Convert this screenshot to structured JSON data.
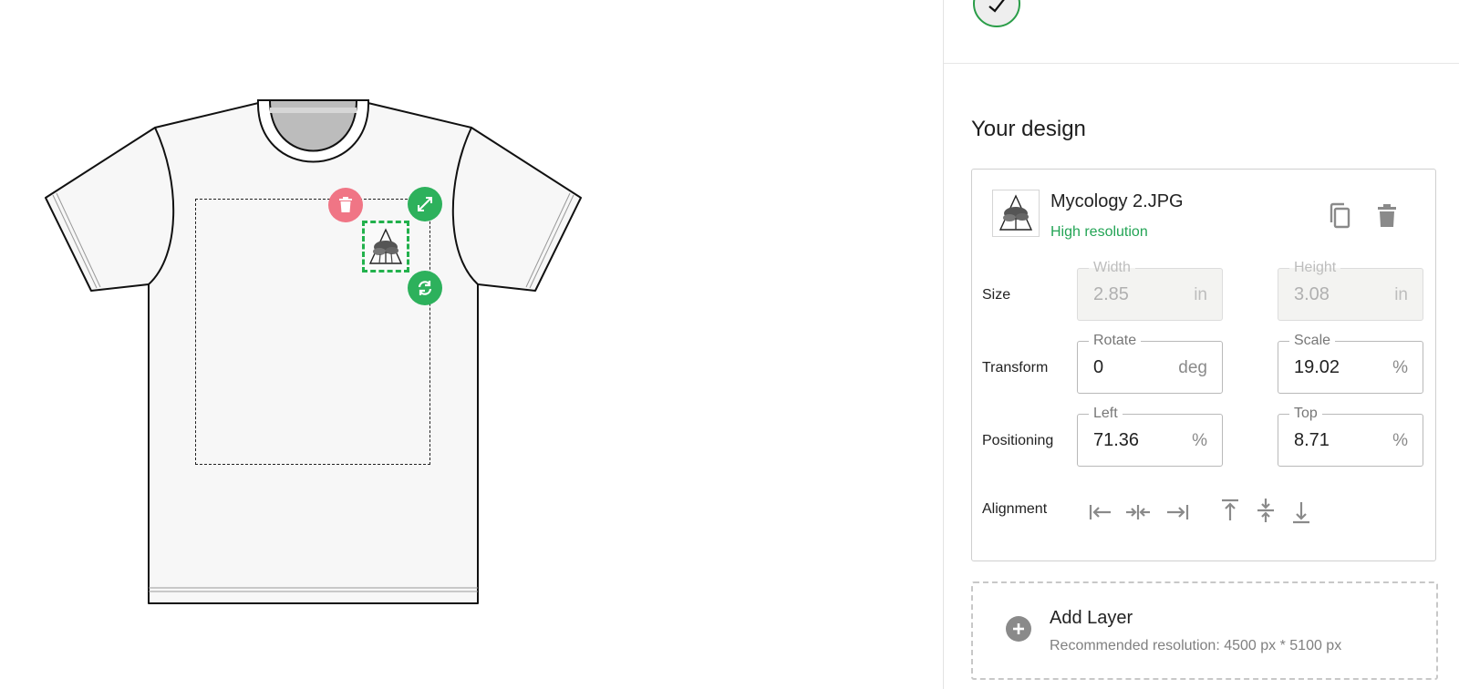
{
  "panel": {
    "title": "Your design",
    "layer": {
      "file_name": "Mycology 2.JPG",
      "resolution_status": "High resolution",
      "size": {
        "label": "Size",
        "width": {
          "legend": "Width",
          "value": "2.85",
          "unit": "in"
        },
        "height": {
          "legend": "Height",
          "value": "3.08",
          "unit": "in"
        }
      },
      "transform": {
        "label": "Transform",
        "rotate": {
          "legend": "Rotate",
          "value": "0",
          "unit": "deg"
        },
        "scale": {
          "legend": "Scale",
          "value": "19.02",
          "unit": "%"
        }
      },
      "positioning": {
        "label": "Positioning",
        "left": {
          "legend": "Left",
          "value": "71.36",
          "unit": "%"
        },
        "top": {
          "legend": "Top",
          "value": "8.71",
          "unit": "%"
        }
      },
      "alignment": {
        "label": "Alignment"
      }
    },
    "add_layer": {
      "title": "Add Layer",
      "subtitle": "Recommended resolution: 4500 px * 5100 px"
    }
  },
  "colors": {
    "accent_green": "#2db15c",
    "delete_pink": "#f07585",
    "status_green": "#23a455"
  },
  "icons": {
    "canvas_handles": [
      "trash-icon",
      "expand-icon",
      "rotate-icon"
    ],
    "layer_actions": [
      "copy-icon",
      "trash-icon"
    ],
    "alignment": [
      "align-left-icon",
      "align-center-horizontal-icon",
      "align-right-icon",
      "align-top-icon",
      "align-center-vertical-icon",
      "align-bottom-icon"
    ]
  }
}
